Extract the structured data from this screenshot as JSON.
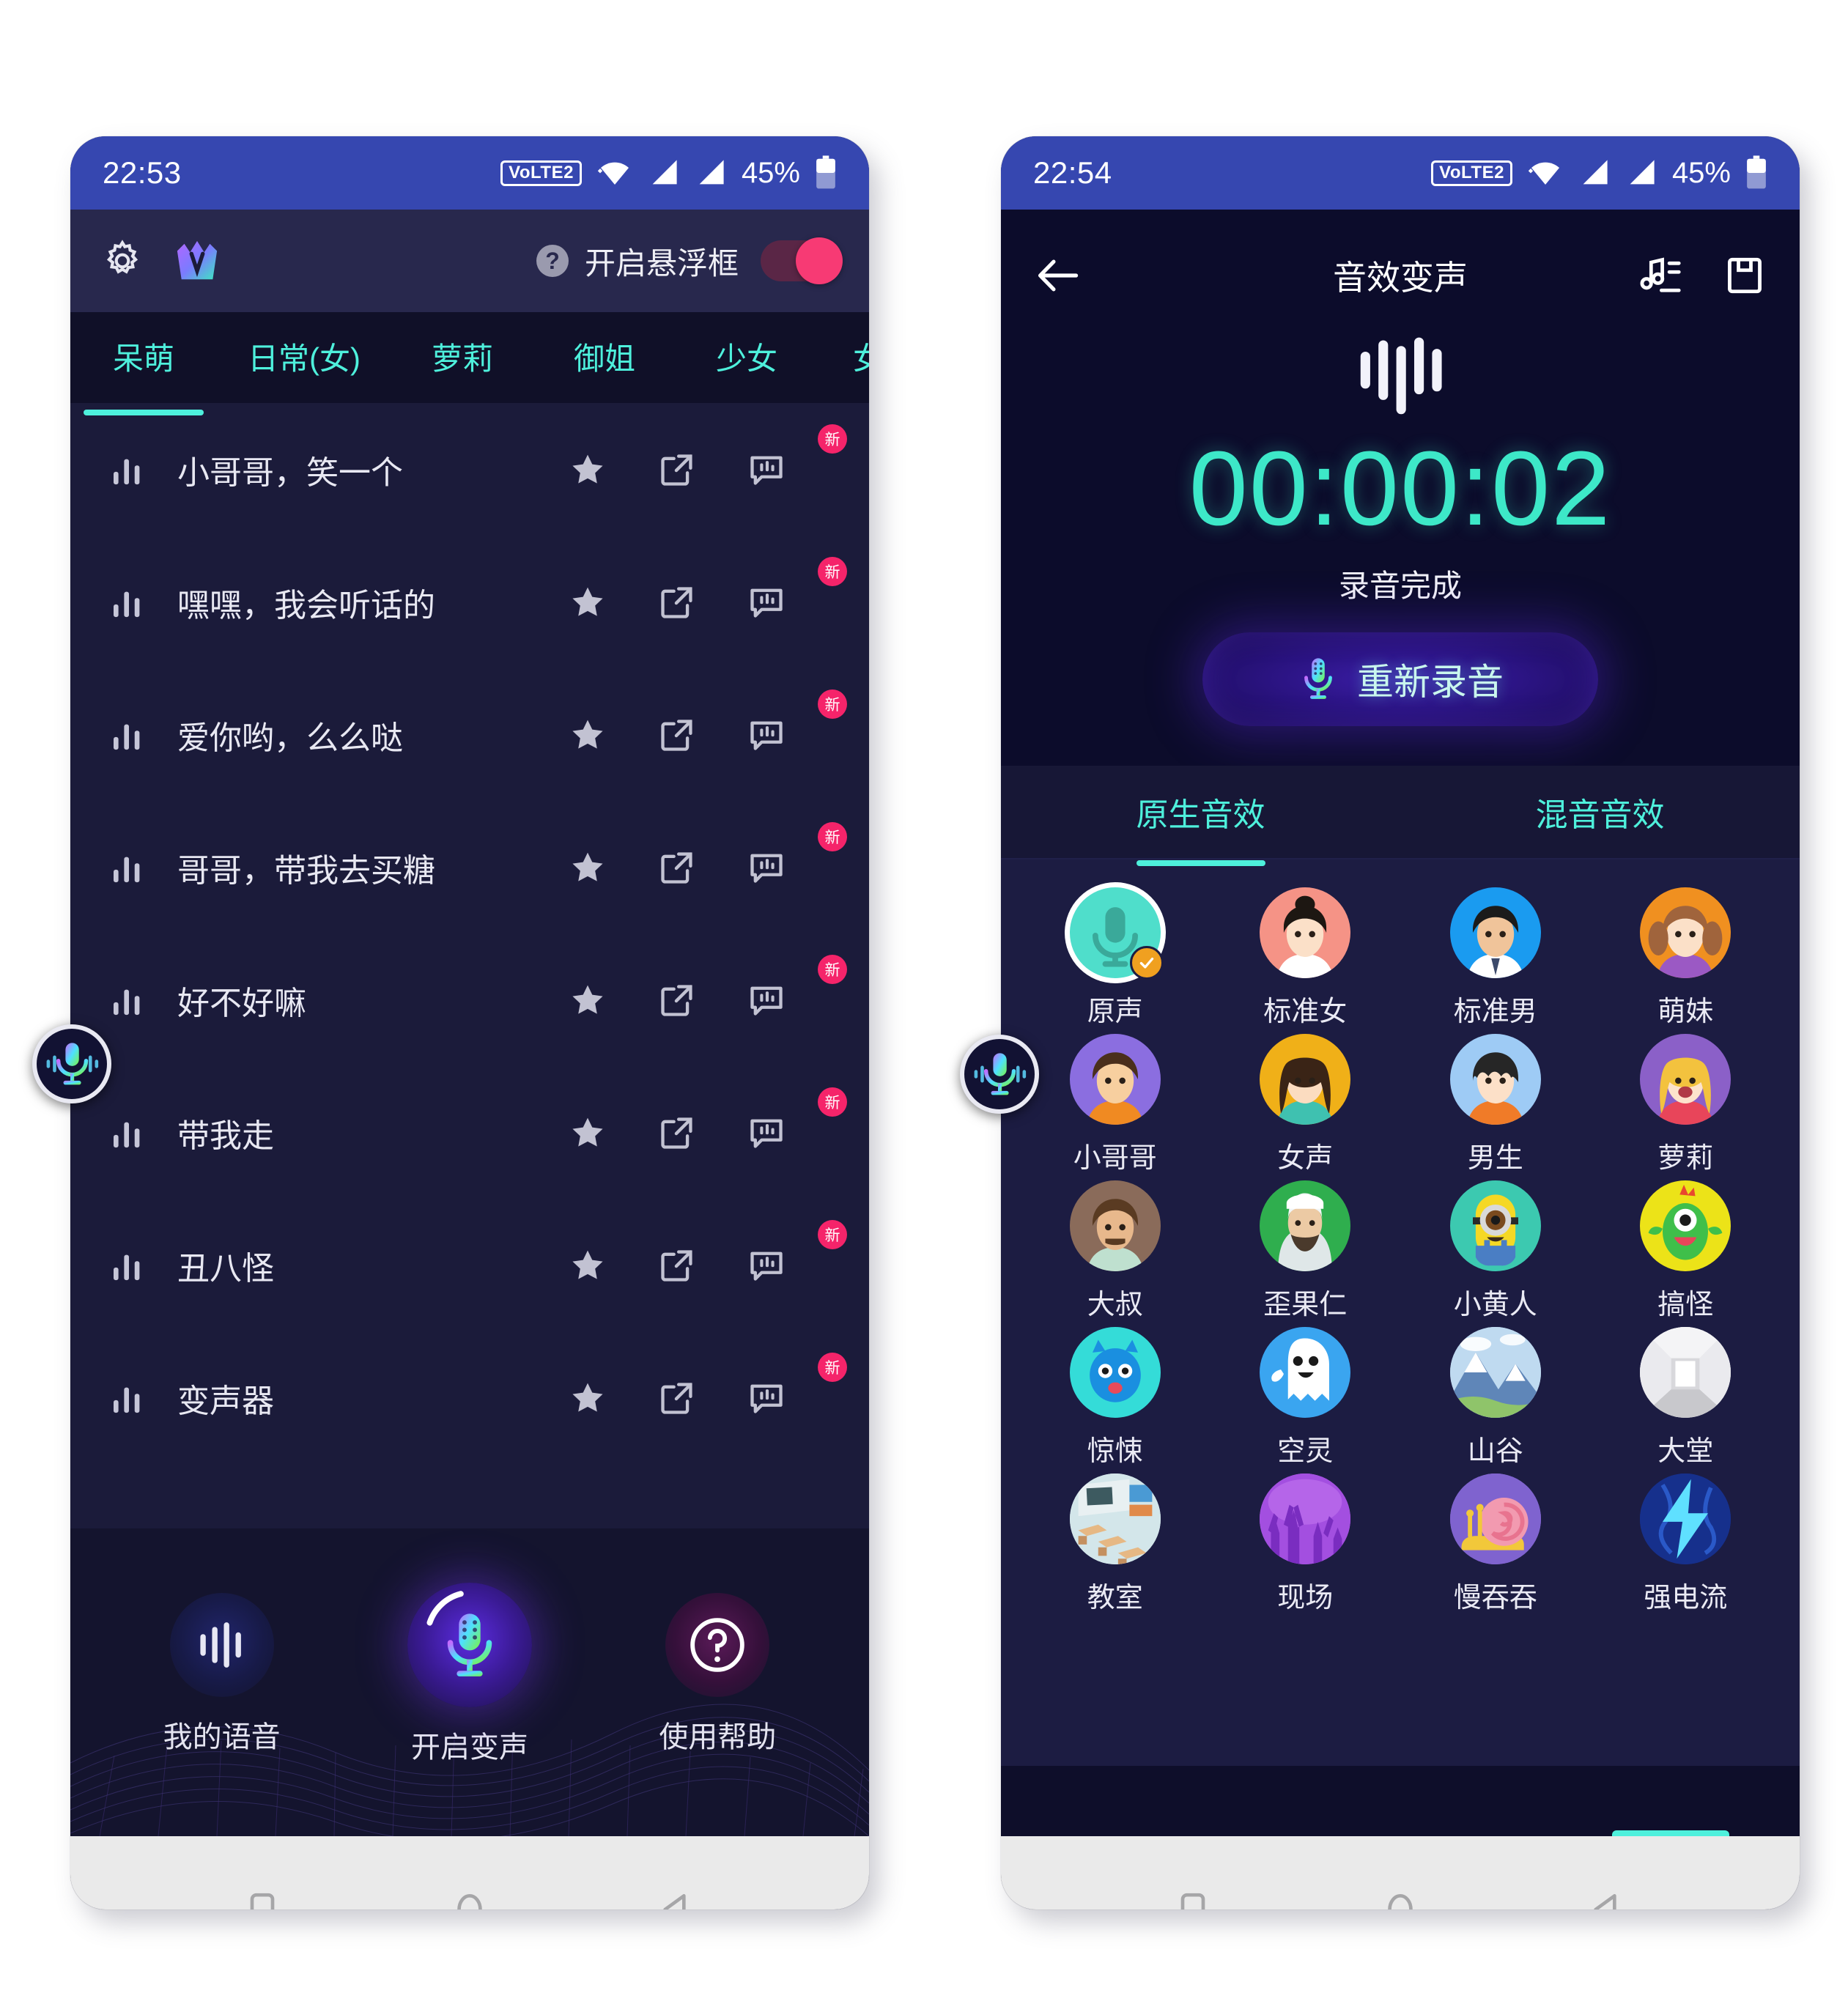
{
  "left_phone": {
    "status_bar": {
      "time": "22:53",
      "volte": "VoLTE2",
      "battery_percent": "45%",
      "icons": [
        "wifi-icon",
        "signal-icon",
        "signal-icon",
        "battery-icon"
      ]
    },
    "toolbar": {
      "settings_icon": "gear-icon",
      "logo_icon": "crown-logo-icon",
      "help_icon": "question-circle-icon",
      "float_label": "开启悬浮框",
      "toggle_on": true,
      "toggle_color": "#f73a74"
    },
    "tabs": {
      "active_index": 0,
      "items": [
        "呆萌",
        "日常(女)",
        "萝莉",
        "御姐",
        "少女",
        "女友"
      ],
      "accent": "#4ef0dc"
    },
    "voice_list": [
      {
        "label": "小哥哥，笑一个",
        "badge": "新"
      },
      {
        "label": "嘿嘿，我会听话的",
        "badge": "新"
      },
      {
        "label": "爱你哟，么么哒",
        "badge": "新"
      },
      {
        "label": "哥哥，带我去买糖",
        "badge": "新"
      },
      {
        "label": "好不好嘛",
        "badge": "新"
      },
      {
        "label": "带我走",
        "badge": "新"
      },
      {
        "label": "丑八怪",
        "badge": "新"
      },
      {
        "label": "变声器",
        "badge": "新"
      }
    ],
    "row_actions": [
      "star-icon",
      "external-link-icon",
      "speech-bubble-icon"
    ],
    "bottom_deck": [
      {
        "label": "我的语音",
        "icon": "waveform-icon"
      },
      {
        "label": "开启变声",
        "icon": "microphone-icon"
      },
      {
        "label": "使用帮助",
        "icon": "question-circle-icon"
      }
    ],
    "floating_bubble": "floating-mic-icon",
    "nav_bar": [
      "square-recents-icon",
      "circle-home-icon",
      "triangle-back-icon"
    ]
  },
  "right_phone": {
    "status_bar": {
      "time": "22:54",
      "volte": "VoLTE2",
      "battery_percent": "45%",
      "icons": [
        "wifi-icon",
        "signal-icon",
        "signal-icon",
        "battery-icon"
      ]
    },
    "header": {
      "back_icon": "arrow-left-icon",
      "title": "音效变声",
      "playlist_icon": "music-note-list-icon",
      "save_icon": "save-floppy-icon"
    },
    "recorder": {
      "wave_icon": "waveform-icon",
      "timer": "00:00:02",
      "status": "录音完成",
      "rerecord_label": "重新录音",
      "rerecord_icon": "microphone-icon",
      "timer_color": "#3de8c8"
    },
    "tabs": {
      "active_index": 0,
      "items": [
        "原生音效",
        "混音音效"
      ],
      "accent": "#4ef0dc"
    },
    "effects": [
      {
        "label": "原声",
        "icon": "microphone-icon",
        "bg": "#4fdecb",
        "selected": true
      },
      {
        "label": "标准女",
        "icon": "woman-face-icon",
        "bg": "#f59386",
        "selected": false
      },
      {
        "label": "标准男",
        "icon": "man-face-icon",
        "bg": "#1a9bf0",
        "selected": false
      },
      {
        "label": "萌妹",
        "icon": "girl-face-icon",
        "bg": "#f09020",
        "selected": false
      },
      {
        "label": "小哥哥",
        "icon": "boy-face-icon",
        "bg": "#8b6ee0",
        "selected": false
      },
      {
        "label": "女声",
        "icon": "woman2-face-icon",
        "bg": "#f0b018",
        "selected": false
      },
      {
        "label": "男生",
        "icon": "boy2-face-icon",
        "bg": "#9ecbf5",
        "selected": false
      },
      {
        "label": "萝莉",
        "icon": "loli-face-icon",
        "bg": "#8b60c8",
        "selected": false
      },
      {
        "label": "大叔",
        "icon": "uncle-face-icon",
        "bg": "#8a6b5a",
        "selected": false
      },
      {
        "label": "歪果仁",
        "icon": "arab-face-icon",
        "bg": "#2fae4e",
        "selected": false
      },
      {
        "label": "小黄人",
        "icon": "minion-icon",
        "bg": "#3cc9b0",
        "selected": false
      },
      {
        "label": "搞怪",
        "icon": "monster-icon",
        "bg": "#ece318",
        "selected": false
      },
      {
        "label": "惊悚",
        "icon": "horror-icon",
        "bg": "#34dcd8",
        "selected": false
      },
      {
        "label": "空灵",
        "icon": "ghost-icon",
        "bg": "#3aa5f0",
        "selected": false
      },
      {
        "label": "山谷",
        "icon": "mountain-icon",
        "bg": "#a8cbe6",
        "selected": false
      },
      {
        "label": "大堂",
        "icon": "hall-icon",
        "bg": "#cfcfd4",
        "selected": false
      },
      {
        "label": "教室",
        "icon": "classroom-icon",
        "bg": "#cfe3e8",
        "selected": false
      },
      {
        "label": "现场",
        "icon": "concert-icon",
        "bg": "#b464e8",
        "selected": false
      },
      {
        "label": "慢吞吞",
        "icon": "snail-icon",
        "bg": "#8a6fd8",
        "selected": false
      },
      {
        "label": "强电流",
        "icon": "lightning-icon",
        "bg": "#1b2f8e",
        "selected": false
      }
    ],
    "floating_bubble": "floating-mic-icon",
    "nav_bar": [
      "square-recents-icon",
      "circle-home-icon",
      "triangle-back-icon"
    ]
  }
}
